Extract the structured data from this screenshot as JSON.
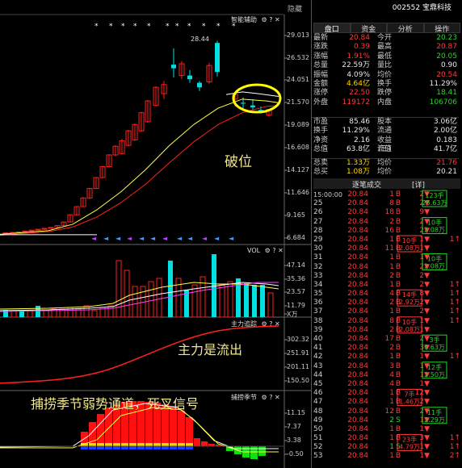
{
  "chart_panel": {
    "hide_button": "隐藏",
    "main_title": "智能辅助",
    "high_label": "28.44",
    "price_axis": [
      "29.013",
      "26.532",
      "24.051",
      "21.570",
      "19.089",
      "16.608",
      "14.127",
      "11.646",
      "9.165",
      "6.684"
    ],
    "vol_title": "VOL",
    "vol_axis": [
      "47.14",
      "35.36",
      "23.57",
      "11.79",
      "X万"
    ],
    "main_force_title": "主力追踪",
    "force_axis": [
      "302.32",
      "251.91",
      "201.11",
      "150.50"
    ],
    "season_title": "捕捞季节",
    "season_axis": [
      "11.15",
      "7.37",
      "3.38",
      "-0.50"
    ],
    "icon_labels": "⚙ ? ✕",
    "annotation_break": "破位",
    "annotation_force": "主力是流出",
    "annotation_season": "捕捞季节弱势通道，死叉信号",
    "colors": {
      "up": "#ff2020",
      "down": "#00e0e0",
      "ma_white": "#ffffff",
      "ma_yellow": "#ffff40",
      "ma_red": "#ff2020",
      "circle": "#ffff00"
    }
  },
  "quote": {
    "code": "002552",
    "name": "宝鼎科技",
    "tabs": [
      "盘口",
      "资金",
      "分析",
      "操作"
    ],
    "rows1": [
      {
        "l": "最新",
        "v": "20.84",
        "vc": "red",
        "l2": "今开",
        "v2": "20.23",
        "v2c": "grn"
      },
      {
        "l": "涨跌",
        "v": "0.39",
        "vc": "red",
        "l2": "最高",
        "v2": "20.87",
        "v2c": "red"
      },
      {
        "l": "涨幅",
        "v": "1.91%",
        "vc": "red",
        "l2": "最低",
        "v2": "20.05",
        "v2c": "grn"
      },
      {
        "l": "总量",
        "v": "22.59万",
        "vc": "wht",
        "l2": "量比",
        "v2": "0.90",
        "v2c": "wht"
      },
      {
        "l": "振幅",
        "v": "4.09%",
        "vc": "wht",
        "l2": "均价",
        "v2": "20.54",
        "v2c": "red"
      },
      {
        "l": "金额",
        "v": "4.64亿",
        "vc": "yel",
        "l2": "换手",
        "v2": "11.29%",
        "v2c": "wht"
      },
      {
        "l": "涨停",
        "v": "22.50",
        "vc": "red",
        "l2": "跌停",
        "v2": "18.41",
        "v2c": "grn"
      },
      {
        "l": "外盘",
        "v": "119172",
        "vc": "red",
        "l2": "内盘",
        "v2": "106706",
        "v2c": "grn"
      }
    ],
    "rows2": [
      {
        "l": "市盈",
        "v": "85.46",
        "vc": "wht",
        "l2": "股本",
        "v2": "3.06亿",
        "v2c": "wht"
      },
      {
        "l": "换手",
        "v": "11.29%",
        "vc": "wht",
        "l2": "流通",
        "v2": "2.00亿",
        "v2c": "wht"
      },
      {
        "l": "净资",
        "v": "2.16",
        "vc": "wht",
        "l2": "收益(三)",
        "v2": "0.183",
        "v2c": "wht"
      },
      {
        "l": "总值",
        "v": "63.8亿",
        "vc": "wht",
        "l2": "流值",
        "v2": "41.7亿",
        "v2c": "wht"
      }
    ],
    "rows3": [
      {
        "l": "总卖",
        "v": "1.33万",
        "vc": "yel",
        "l2": "均价",
        "v2": "21.76",
        "v2c": "red"
      },
      {
        "l": "总买",
        "v": "1.08万",
        "vc": "yel",
        "l2": "均价",
        "v2": "20.21",
        "v2c": "wht"
      }
    ],
    "deal_title": "逐笔成交",
    "deal_detail": "[详]",
    "deals": [
      {
        "t": "15:00:00",
        "p": "20.84",
        "n": "1",
        "d": "B"
      },
      {
        "t": "25",
        "p": "20.84",
        "n": "8",
        "d": "B"
      },
      {
        "t": "26",
        "p": "20.84",
        "n": "18",
        "d": "B"
      },
      {
        "t": "27",
        "p": "20.84",
        "n": "2",
        "d": "B"
      },
      {
        "t": "28",
        "p": "20.84",
        "n": "16",
        "d": "B"
      },
      {
        "t": "29",
        "p": "20.84",
        "n": "1",
        "d": "B"
      },
      {
        "t": "30",
        "p": "20.84",
        "n": "11",
        "d": "B"
      },
      {
        "t": "31",
        "p": "20.84",
        "n": "1",
        "d": "B"
      },
      {
        "t": "32",
        "p": "20.84",
        "n": "1",
        "d": "B"
      },
      {
        "t": "33",
        "p": "20.84",
        "n": "2",
        "d": "B"
      },
      {
        "t": "34",
        "p": "20.84",
        "n": "1",
        "d": "B"
      },
      {
        "t": "35",
        "p": "20.84",
        "n": "4",
        "d": "B"
      },
      {
        "t": "36",
        "p": "20.84",
        "n": "2",
        "d": "B"
      },
      {
        "t": "37",
        "p": "20.84",
        "n": "1",
        "d": "B"
      },
      {
        "t": "38",
        "p": "20.84",
        "n": "8",
        "d": "B"
      },
      {
        "t": "39",
        "p": "20.84",
        "n": "2",
        "d": "B"
      },
      {
        "t": "40",
        "p": "20.84",
        "n": "17",
        "d": "B"
      },
      {
        "t": "41",
        "p": "20.84",
        "n": "2",
        "d": "B"
      },
      {
        "t": "42",
        "p": "20.84",
        "n": "1",
        "d": "B"
      },
      {
        "t": "43",
        "p": "20.84",
        "n": "3",
        "d": "B"
      },
      {
        "t": "44",
        "p": "20.84",
        "n": "4",
        "d": "B"
      },
      {
        "t": "45",
        "p": "20.84",
        "n": "4",
        "d": "B"
      },
      {
        "t": "46",
        "p": "20.84",
        "n": "1",
        "d": "B"
      },
      {
        "t": "47",
        "p": "20.84",
        "n": "1",
        "d": "B"
      },
      {
        "t": "48",
        "p": "20.84",
        "n": "12",
        "d": "B"
      },
      {
        "t": "49",
        "p": "20.84",
        "n": "2",
        "d": "S"
      },
      {
        "t": "50",
        "p": "20.84",
        "n": "1",
        "d": "B"
      },
      {
        "t": "51",
        "p": "20.84",
        "n": "1",
        "d": "B"
      },
      {
        "t": "52",
        "p": "20.84",
        "n": "1",
        "d": "S"
      },
      {
        "t": "53",
        "p": "20.84",
        "n": "1",
        "d": "B"
      }
    ],
    "col3": [
      {
        "v": "2",
        "a": "▼"
      },
      {
        "v": "2",
        "a": "▼"
      },
      {
        "v": "9",
        "a": "▼"
      },
      {
        "v": "2",
        "a": "▼"
      },
      {
        "v": "2",
        "a": "▼"
      },
      {
        "v": "1",
        "a": "▼"
      },
      {
        "v": "1",
        "a": "▼"
      },
      {
        "v": "1",
        "a": "▼"
      },
      {
        "v": "2",
        "a": "▼"
      },
      {
        "v": "2",
        "a": "▼"
      },
      {
        "v": "2",
        "a": "▼"
      },
      {
        "v": "8",
        "a": "▼"
      },
      {
        "v": "2",
        "a": "▼"
      },
      {
        "v": "2",
        "a": "▼"
      },
      {
        "v": "1",
        "a": "▼"
      },
      {
        "v": "1",
        "a": "▼"
      },
      {
        "v": "2",
        "a": "▼"
      },
      {
        "v": "3",
        "a": "▼"
      },
      {
        "v": "1",
        "a": "▼"
      },
      {
        "v": "1",
        "a": "▼"
      },
      {
        "v": "1",
        "a": "▼"
      },
      {
        "v": "1",
        "a": "▼"
      },
      {
        "v": "12",
        "a": "▼"
      },
      {
        "v": "2",
        "a": "▼"
      },
      {
        "v": "2",
        "a": "▼"
      },
      {
        "v": "1",
        "a": "▼"
      },
      {
        "v": "1",
        "a": "▼"
      },
      {
        "v": "3",
        "a": "▼"
      },
      {
        "v": "1",
        "a": "▼"
      },
      {
        "v": "1",
        "a": "▼"
      }
    ],
    "col5": [
      {
        "v": "",
        "a": ""
      },
      {
        "v": "",
        "a": ""
      },
      {
        "v": "",
        "a": ""
      },
      {
        "v": "",
        "a": ""
      },
      {
        "v": "",
        "a": ""
      },
      {
        "v": "1",
        "a": "↑"
      },
      {
        "v": "",
        "a": ""
      },
      {
        "v": "",
        "a": ""
      },
      {
        "v": "",
        "a": ""
      },
      {
        "v": "",
        "a": ""
      },
      {
        "v": "1",
        "a": "↑"
      },
      {
        "v": "1",
        "a": "↑"
      },
      {
        "v": "1",
        "a": "↑"
      },
      {
        "v": "1",
        "a": "↑"
      },
      {
        "v": "1",
        "a": "↑"
      },
      {
        "v": "",
        "a": ""
      },
      {
        "v": "",
        "a": ""
      },
      {
        "v": "",
        "a": ""
      },
      {
        "v": "1",
        "a": "↑"
      },
      {
        "v": "",
        "a": ""
      },
      {
        "v": "",
        "a": ""
      },
      {
        "v": "",
        "a": ""
      },
      {
        "v": "",
        "a": ""
      },
      {
        "v": "",
        "a": ""
      },
      {
        "v": "",
        "a": ""
      },
      {
        "v": "",
        "a": ""
      },
      {
        "v": "",
        "a": ""
      },
      {
        "v": "1",
        "a": "↑"
      },
      {
        "v": "1",
        "a": "↑"
      },
      {
        "v": "2",
        "a": "↑"
      }
    ],
    "boxes_mid": [
      {
        "top": "10手",
        "bot": "2.08万",
        "row": 5
      },
      {
        "top": "14手",
        "bot": "2.92万",
        "row": 11
      },
      {
        "top": "10手",
        "bot": "2.08万",
        "row": 14
      },
      {
        "top": "7手",
        "bot": "1.46万",
        "row": 22
      },
      {
        "top": "23手",
        "bot": "4.79万",
        "row": 27
      }
    ],
    "boxes_right": [
      {
        "top": "123手",
        "bot": "25.63万",
        "row": 0
      },
      {
        "top": "10手",
        "bot": "2.08万",
        "row": 3
      },
      {
        "top": "10手",
        "bot": "2.08万",
        "row": 7
      },
      {
        "top": "3手",
        "bot": "0.63万",
        "row": 16
      },
      {
        "top": "12手",
        "bot": "2.50万",
        "row": 19
      },
      {
        "top": "11手",
        "bot": "2.29万",
        "row": 24
      }
    ]
  }
}
